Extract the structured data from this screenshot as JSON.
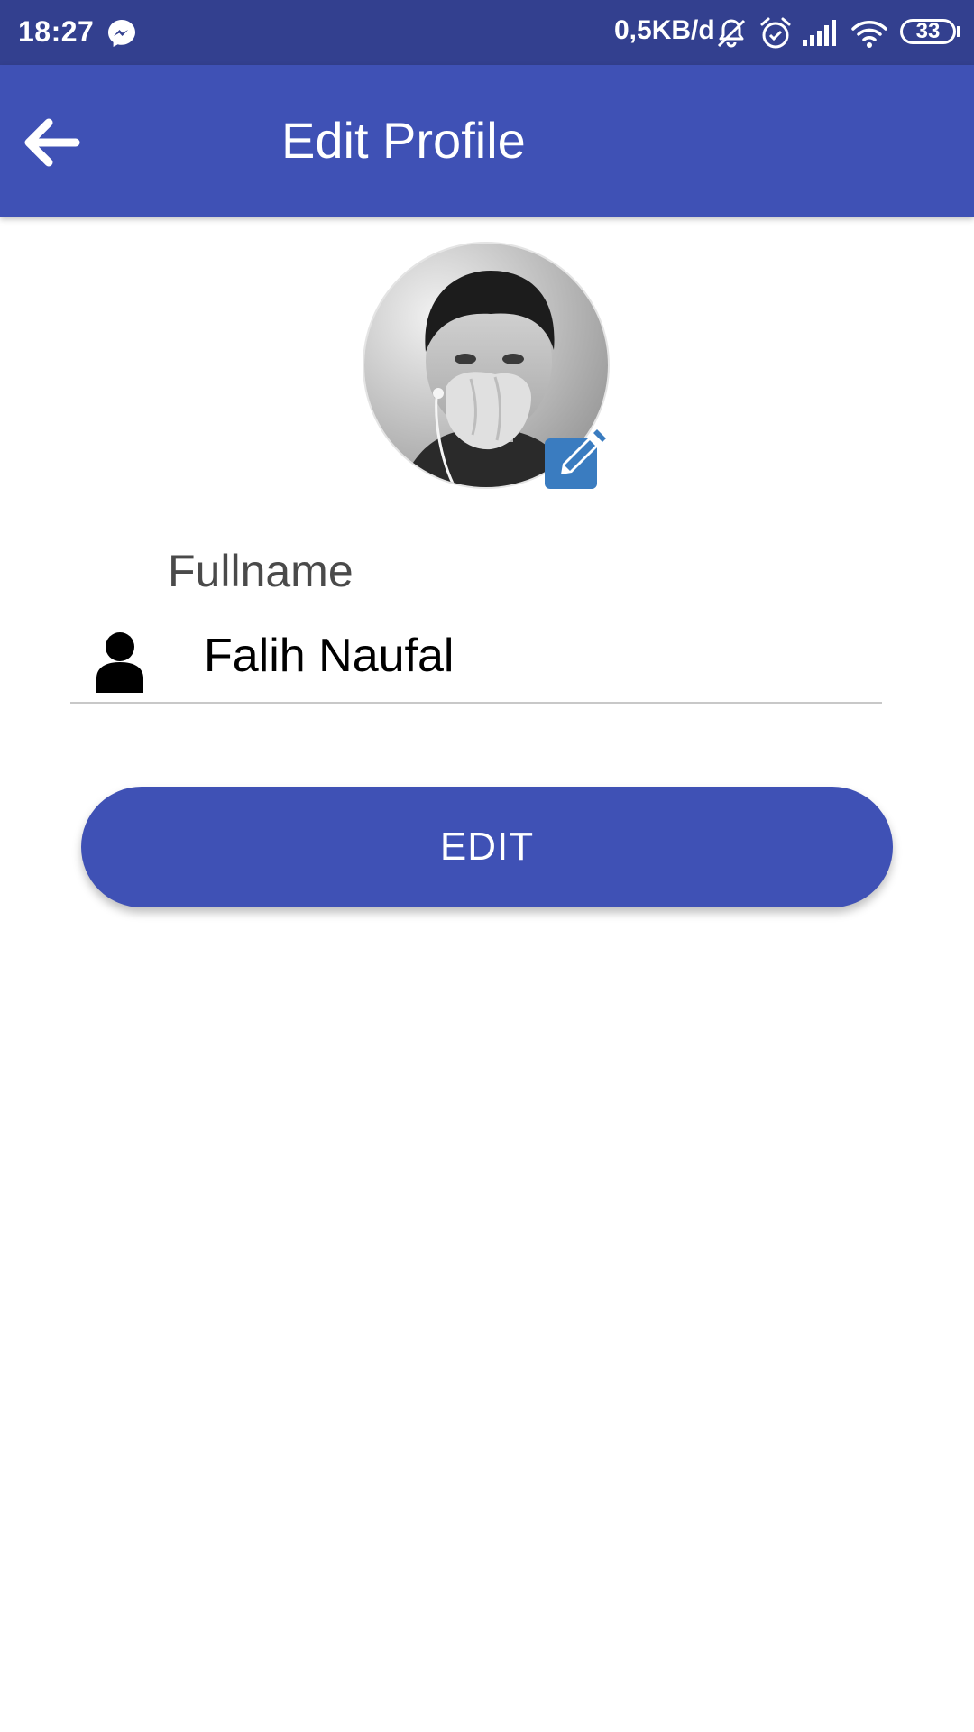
{
  "status_bar": {
    "time": "18:27",
    "network_speed": "0,5KB/d",
    "battery_level": "33",
    "icons": [
      "messenger-icon",
      "mute-icon",
      "alarm-icon",
      "signal-icon",
      "wifi-icon",
      "battery-icon"
    ]
  },
  "app_bar": {
    "title": "Edit Profile",
    "back_icon": "arrow-left-icon"
  },
  "profile": {
    "avatar_icon": "profile-photo",
    "edit_photo_icon": "pencil-square-icon"
  },
  "form": {
    "fullname_label": "Fullname",
    "fullname_value": "Falih Naufal",
    "field_icon": "person-icon"
  },
  "actions": {
    "edit_label": "EDIT"
  },
  "colors": {
    "status_bar": "#33408f",
    "primary": "#3f51b5",
    "edit_photo_badge": "#3a7cc0",
    "underline": "#c8c8c8"
  }
}
